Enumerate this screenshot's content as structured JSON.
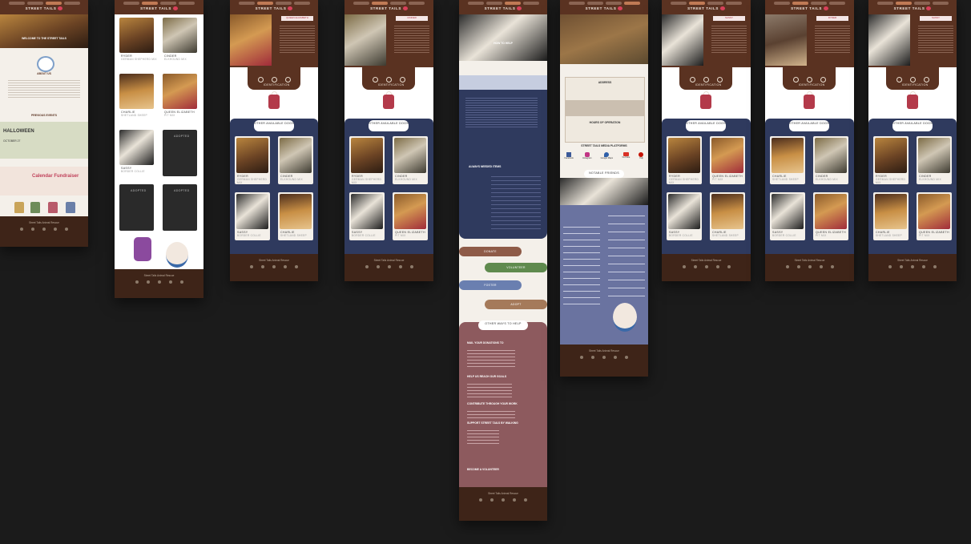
{
  "brand": {
    "name": "STREET TAILS"
  },
  "boards": {
    "home": {
      "hero_title": "WELCOME TO THE STREET TAILS",
      "about_heading": "ABOUT US",
      "events_heading": "PREVIOUS EVENTS",
      "event_1": "HALLOWEEN",
      "event_1_date": "OCTOBER 27",
      "event_2": "Calendar Fundraiser",
      "footer_icons": [
        "paw-icon",
        "youtube-icon",
        "facebook-icon",
        "pin-icon",
        "camera-icon"
      ]
    },
    "adopt": {
      "dogs": [
        {
          "name": "RYDER",
          "breed": "GERMAN SHEPHERD MIX"
        },
        {
          "name": "CINDER",
          "breed": "ELKHOUND MIX"
        },
        {
          "name": "CHARLIE",
          "breed": "SHETLAND SHEEP"
        },
        {
          "name": "QUEEN ELIZABETH",
          "breed": "PIT MIX"
        },
        {
          "name": "SASSY",
          "breed": "BORDER COLLIE"
        },
        {
          "name": "ADOPTED",
          "breed": ""
        },
        {
          "name": "ADOPTED",
          "breed": ""
        },
        {
          "name": "ADOPTED",
          "breed": ""
        }
      ]
    },
    "profile": {
      "name_tag": "QUEEN ELIZABETH",
      "id_label": "IDENTIFICATION",
      "other_dogs": "OTHER AVAILABLE DOGS",
      "cards": [
        {
          "name": "RYDER",
          "breed": "GERMAN SHEPHERD MIX"
        },
        {
          "name": "CINDER",
          "breed": "ELKHOUND MIX"
        },
        {
          "name": "SASSY",
          "breed": "BORDER COLLIE"
        },
        {
          "name": "CHARLIE",
          "breed": "SHETLAND SHEEP"
        }
      ]
    },
    "profile2": {
      "name_tag": "CINDER",
      "cards": [
        {
          "name": "RYDER",
          "breed": "GERMAN SHEPHERD MIX"
        },
        {
          "name": "CINDER",
          "breed": "ELKHOUND MIX"
        },
        {
          "name": "SASSY",
          "breed": "BORDER COLLIE"
        },
        {
          "name": "QUEEN ELIZABETH",
          "breed": "PIT MIX"
        }
      ]
    },
    "help": {
      "hero_title": "HOW TO HELP",
      "needed_heading": "ALWAYS NEEDED ITEMS",
      "buttons": [
        "DONATE",
        "VOLUNTEER",
        "FOSTER",
        "ADOPT"
      ],
      "other_ways": "OTHER WAYS TO HELP",
      "sections": [
        "MAIL YOUR DONATIONS TO",
        "HELP US REACH OUR GOALS",
        "CONTRIBUTE THROUGH YOUR WORK",
        "SUPPORT STREET TAILS BY WALKING",
        "BECOME A VOLUNTEER"
      ]
    },
    "contact": {
      "address_heading": "ADDRESS",
      "hours_heading": "HOURS OF OPERATION",
      "social_heading": "STREET TAILS MEDIA PLATFORMS",
      "social": [
        "Facebook",
        "Instagram",
        "Google Maps",
        "YouTube",
        "Yelp"
      ],
      "friends_heading": "NOTABLE FRIENDS"
    },
    "profile3": {
      "name_tag": "SASSY",
      "cards": [
        {
          "name": "RYDER",
          "breed": "GERMAN SHEPHERD MIX"
        },
        {
          "name": "QUEEN ELIZABETH",
          "breed": "PIT MIX"
        },
        {
          "name": "SASSY",
          "breed": "BORDER COLLIE"
        },
        {
          "name": "CHARLIE",
          "breed": "SHETLAND SHEEP"
        }
      ]
    },
    "profile4": {
      "name_tag": "RYDER",
      "cards": [
        {
          "name": "CHARLIE",
          "breed": "SHETLAND SHEEP"
        },
        {
          "name": "CINDER",
          "breed": "ELKHOUND MIX"
        },
        {
          "name": "SASSY",
          "breed": "BORDER COLLIE"
        },
        {
          "name": "QUEEN ELIZABETH",
          "breed": "PIT MIX"
        }
      ]
    },
    "profile5": {
      "name_tag": "SASSY",
      "cards": [
        {
          "name": "RYDER",
          "breed": "GERMAN SHEPHERD MIX"
        },
        {
          "name": "CINDER",
          "breed": "ELKHOUND MIX"
        },
        {
          "name": "CHARLIE",
          "breed": "SHETLAND SHEEP"
        },
        {
          "name": "QUEEN ELIZABETH",
          "breed": "PIT MIX"
        }
      ]
    }
  },
  "colors": {
    "background": "#1b1b1b",
    "brown": "#5a3221",
    "navy": "#2f3a5e",
    "pink": "#b33a4a",
    "mauve": "#8d5a5e"
  }
}
